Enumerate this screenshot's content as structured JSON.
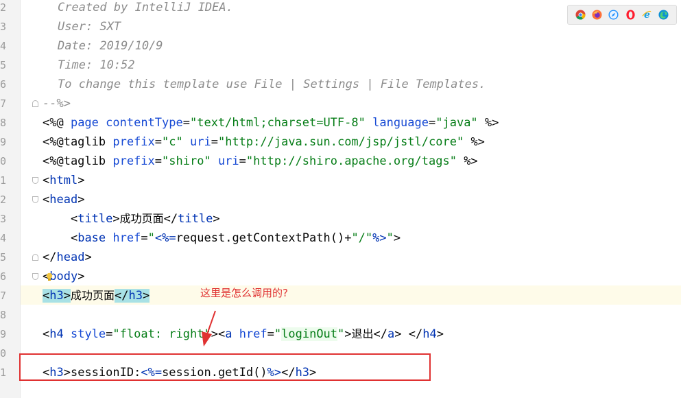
{
  "editor": {
    "line_numbers": [
      "2",
      "3",
      "4",
      "5",
      "6",
      "7",
      "8",
      "9",
      "0",
      "1",
      "2",
      "3",
      "4",
      "5",
      "6",
      "7",
      "8",
      "9",
      "0",
      "1"
    ],
    "lines": {
      "l2": "Created by IntelliJ IDEA.",
      "l3": "User: SXT",
      "l4": "Date: 2019/10/9",
      "l5": "Time: 10:52",
      "l6": "To change this template use File | Settings | File Templates.",
      "l7": "--%>",
      "l8": {
        "open": "<%@ ",
        "k1": "page ",
        "a1": "contentType",
        "eq1": "=",
        "v1": "\"text/html;charset=UTF-8\"",
        "sp": " ",
        "a2": "language",
        "eq2": "=",
        "v2": "\"java\"",
        "close": " %>"
      },
      "l9": {
        "open": "<%@taglib ",
        "a1": "prefix",
        "eq1": "=",
        "v1": "\"c\"",
        "sp": " ",
        "a2": "uri",
        "eq2": "=",
        "v2": "\"http://java.sun.com/jsp/jstl/core\"",
        "close": " %>"
      },
      "l10": {
        "open": "<%@taglib ",
        "a1": "prefix",
        "eq1": "=",
        "v1": "\"shiro\"",
        "sp": " ",
        "a2": "uri",
        "eq2": "=",
        "v2": "\"http://shiro.apache.org/tags\"",
        "close": " %>"
      },
      "l11": {
        "lt": "<",
        "tag": "html",
        "gt": ">"
      },
      "l12": {
        "lt": "<",
        "tag": "head",
        "gt": ">"
      },
      "l13": {
        "indent": "    ",
        "lt": "<",
        "tag": "title",
        "gt": ">",
        "text": "成功页面",
        "lt2": "</",
        "tag2": "title",
        "gt2": ">"
      },
      "l14": {
        "indent": "    ",
        "lt": "<",
        "tag": "base ",
        "a1": "href",
        "eq1": "=",
        "q1": "\"",
        "inj_open": "<%=",
        "expr": "request.getContextPath()+",
        "s": "\"/\"",
        "inj_close": "%>",
        "q2": "\"",
        "gt": ">"
      },
      "l15": {
        "lt": "</",
        "tag": "head",
        "gt": ">"
      },
      "l16": {
        "lt": "<",
        "tag": "body",
        "gt": ">"
      },
      "l17": {
        "lt": "<",
        "tag": "h3",
        "gt": ">",
        "text": "成功页面",
        "lt2": "</",
        "tag2": "h3",
        "gt2": ">"
      },
      "l18": "",
      "l19": {
        "lt": "<",
        "tag": "h4 ",
        "a1": "style",
        "eq1": "=",
        "v1": "\"float: right\"",
        "gt": ">",
        "lt_a": "<",
        "tag_a": "a ",
        "a2": "href",
        "eq2": "=",
        "v2a": "\"",
        "v2b": "loginOut",
        "v2c": "\"",
        "gt_a": ">",
        "text": "退出",
        "lt2": "</",
        "tag2": "a",
        "gt2": "> ",
        "lt3": "</",
        "tag3": "h4",
        "gt3": ">"
      },
      "l20": "",
      "l21": {
        "lt": "<",
        "tag": "h3",
        "gt": ">",
        "text": "sessionID:",
        "inj_open": "<%=",
        "expr": "session.getId()",
        "inj_close": "%>",
        "lt2": "</",
        "tag2": "h3",
        "gt2": ">"
      }
    }
  },
  "annotation": {
    "text": "这里是怎么调用的?",
    "color": "#e03131"
  },
  "browser_icons": [
    "chrome-icon",
    "firefox-icon",
    "safari-icon",
    "opera-icon",
    "ie-icon",
    "edge-icon"
  ]
}
